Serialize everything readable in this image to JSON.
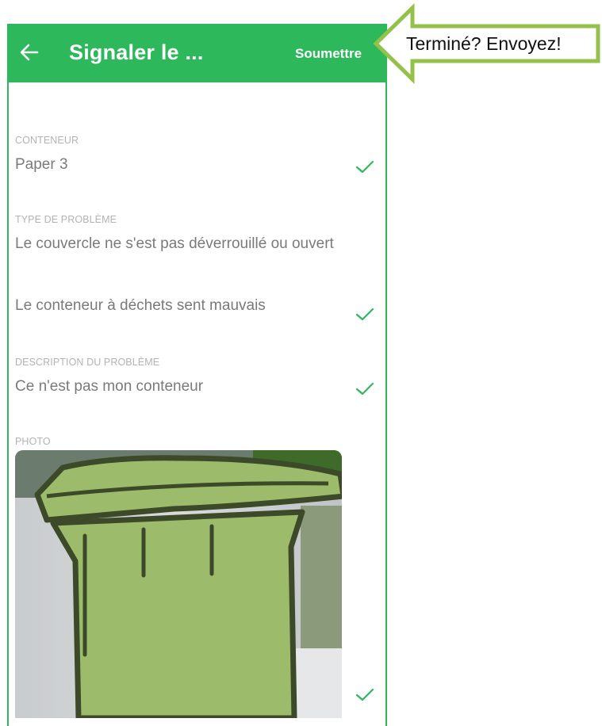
{
  "appbar": {
    "title": "Signaler le ...",
    "submit_label": "Soumettre",
    "back_icon": "arrow-left-icon"
  },
  "form": {
    "container": {
      "label": "CONTENEUR",
      "value": "Paper 3"
    },
    "problem_type": {
      "label": "TYPE DE PROBLÈME",
      "options": [
        "Le couvercle ne s'est pas déverrouillé ou ouvert",
        "Le conteneur à déchets sent mauvais"
      ]
    },
    "description": {
      "label": "DESCRIPTION DU PROBLÈME",
      "value": "Ce n'est pas mon conteneur"
    },
    "photo": {
      "label": "PHOTO"
    }
  },
  "callout": {
    "text": "Terminé? Envoyez!"
  },
  "colors": {
    "primary": "#2eb85c",
    "check": "#2eb85c",
    "label": "#b3b3b3",
    "value": "#7a7a7a"
  }
}
